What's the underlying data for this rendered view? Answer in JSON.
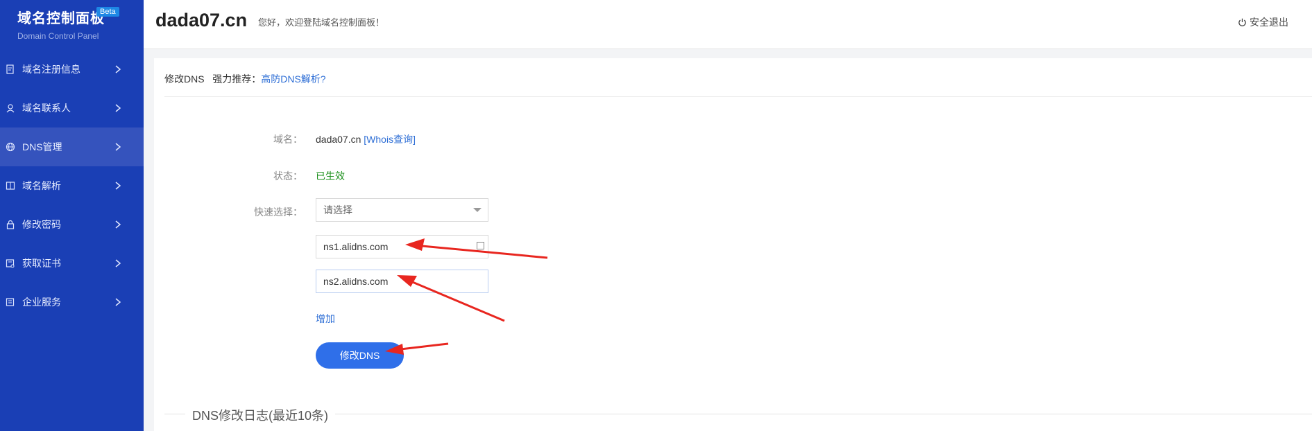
{
  "sidebar": {
    "brand": "域名控制面板",
    "badge": "Beta",
    "subtitle": "Domain Control Panel",
    "items": [
      {
        "label": "域名注册信息",
        "icon": "document-icon"
      },
      {
        "label": "域名联系人",
        "icon": "user-icon"
      },
      {
        "label": "DNS管理",
        "icon": "globe-icon"
      },
      {
        "label": "域名解析",
        "icon": "resolve-icon"
      },
      {
        "label": "修改密码",
        "icon": "lock-icon"
      },
      {
        "label": "获取证书",
        "icon": "certificate-icon"
      },
      {
        "label": "企业服务",
        "icon": "service-icon"
      }
    ],
    "active_index": 2
  },
  "header": {
    "domain": "dada07.cn",
    "welcome": "您好，欢迎登陆域名控制面板！",
    "logout": "安全退出"
  },
  "panel": {
    "crumb_prefix": "修改DNS",
    "crumb_recommend": "强力推荐：",
    "crumb_link": "高防DNS解析?",
    "domain_label": "域名：",
    "domain_value": "dada07.cn",
    "whois_link": "[Whois查询]",
    "status_label": "状态：",
    "status_value": "已生效",
    "quick_label": "快速选择：",
    "quick_value": "请选择",
    "ns1": "ns1.alidns.com",
    "ns2": "ns2.alidns.com",
    "add_label": "增加",
    "submit_label": "修改DNS",
    "log_title": "DNS修改日志(最近10条)"
  },
  "colors": {
    "sidebar_bg": "#1a3fb5",
    "accent": "#2f6fe9",
    "status_ok": "#1a8f1a",
    "annotation": "#e8261f"
  }
}
